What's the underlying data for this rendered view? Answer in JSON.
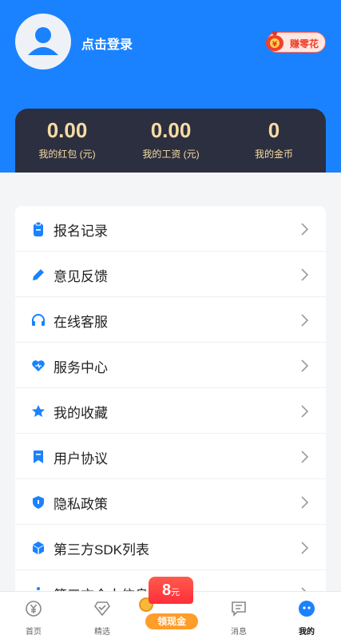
{
  "header": {
    "login_text": "点击登录",
    "earn_label": "赚零花",
    "earn_symbol": "¥",
    "brand_color": "#1a82ff"
  },
  "stats": [
    {
      "value": "0.00",
      "label": "我的红包 (元)"
    },
    {
      "value": "0.00",
      "label": "我的工资 (元)"
    },
    {
      "value": "0",
      "label": "我的金币"
    }
  ],
  "menu": {
    "items": [
      {
        "label": "报名记录",
        "icon": "clipboard-icon"
      },
      {
        "label": "意见反馈",
        "icon": "pencil-icon"
      },
      {
        "label": "在线客服",
        "icon": "headset-icon"
      },
      {
        "label": "服务中心",
        "icon": "heart-icon"
      },
      {
        "label": "我的收藏",
        "icon": "star-icon"
      },
      {
        "label": "用户协议",
        "icon": "bookmark-icon"
      },
      {
        "label": "隐私政策",
        "icon": "shield-icon"
      },
      {
        "label": "第三方SDK列表",
        "icon": "cube-icon"
      },
      {
        "label": "第三方个人信息清单",
        "icon": "info-icon"
      }
    ]
  },
  "cash_reward": {
    "amount": "8",
    "unit": "元",
    "label": "领现金"
  },
  "tabbar": {
    "tabs": [
      {
        "label": "首页",
        "icon": "yen-icon"
      },
      {
        "label": "精选",
        "icon": "diamond-check-icon"
      },
      {
        "label": "消息",
        "icon": "message-icon"
      },
      {
        "label": "我的",
        "icon": "profile-face-icon"
      }
    ],
    "active": "我的"
  }
}
